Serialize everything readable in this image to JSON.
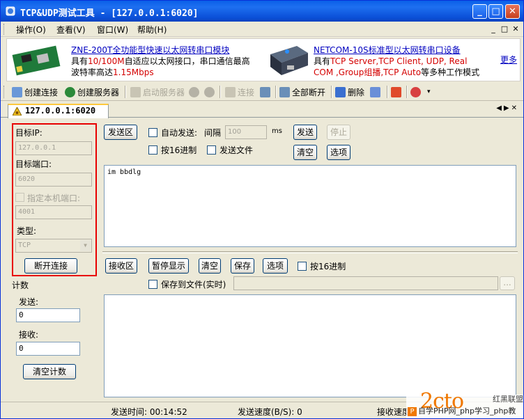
{
  "window": {
    "title": "TCP&UDP测试工具 - [127.0.0.1:6020]",
    "min_glyph": "_",
    "max_glyph": "□",
    "close_glyph": "✕"
  },
  "menu": {
    "items": [
      "操作(O)",
      "查看(V)",
      "窗口(W)",
      "帮助(H)"
    ],
    "mdi_min": "_",
    "mdi_max": "□",
    "mdi_close": "✕"
  },
  "ad": {
    "left_title": "ZNE-200T全功能型快速以太网转串口模块",
    "left_l1_a": "具有",
    "left_l1_b": "10/100M",
    "left_l1_c": "自适应以太网接口，串口通信最高",
    "left_l2_a": "波特率高达",
    "left_l2_b": "1.15Mbps",
    "right_title": "NETCOM-10S标准型以太网转串口设备",
    "right_l1_a": "具有",
    "right_l1_b": "TCP Server,TCP Client, UDP, Real",
    "right_l2_a": "COM ,Group组播,TCP Auto",
    "right_l2_b": "等多种工作模式",
    "more": "更多"
  },
  "toolbar": {
    "create_conn": "创建连接",
    "create_server": "创建服务器",
    "start_server": "启动服务器",
    "connect": "连接",
    "disconnect_all": "全部断开",
    "delete": "删除"
  },
  "tab": {
    "label": "127.0.0.1:6020",
    "nav": "◀▶✕"
  },
  "left": {
    "target_ip_label": "目标IP:",
    "target_ip": "127.0.0.1",
    "target_port_label": "目标端口:",
    "target_port": "6020",
    "local_port_label": "指定本机端口:",
    "local_port": "4001",
    "type_label": "类型:",
    "type_value": "TCP",
    "disconnect_btn": "断开连接",
    "count_label": "计数",
    "send_label": "发送:",
    "send_value": "0",
    "recv_label": "接收:",
    "recv_value": "0",
    "clear_count_btn": "清空计数"
  },
  "send": {
    "area_btn": "发送区",
    "auto_send": "自动发送:",
    "interval_label": "间隔",
    "interval_value": "100",
    "interval_unit": "ms",
    "send_btn": "发送",
    "stop_btn": "停止",
    "hex": "按16进制",
    "send_file": "发送文件",
    "clear_btn": "清空",
    "options_btn": "选项",
    "content": "im bbdlg"
  },
  "recv": {
    "area_btn": "接收区",
    "pause_btn": "暂停显示",
    "clear_btn": "清空",
    "save_btn": "保存",
    "options_btn": "选项",
    "hex": "按16进制",
    "save_file": "保存到文件(实时)",
    "browse": "...",
    "content": ""
  },
  "status": {
    "send_time": "发送时间: 00:14:52",
    "send_speed": "发送速度(B/S): 0",
    "recv_speed": "接收速度"
  },
  "watermark": {
    "logo": "2cto",
    "tag": "红黑联盟",
    "text": "自学PHP网_php学习_php教"
  }
}
